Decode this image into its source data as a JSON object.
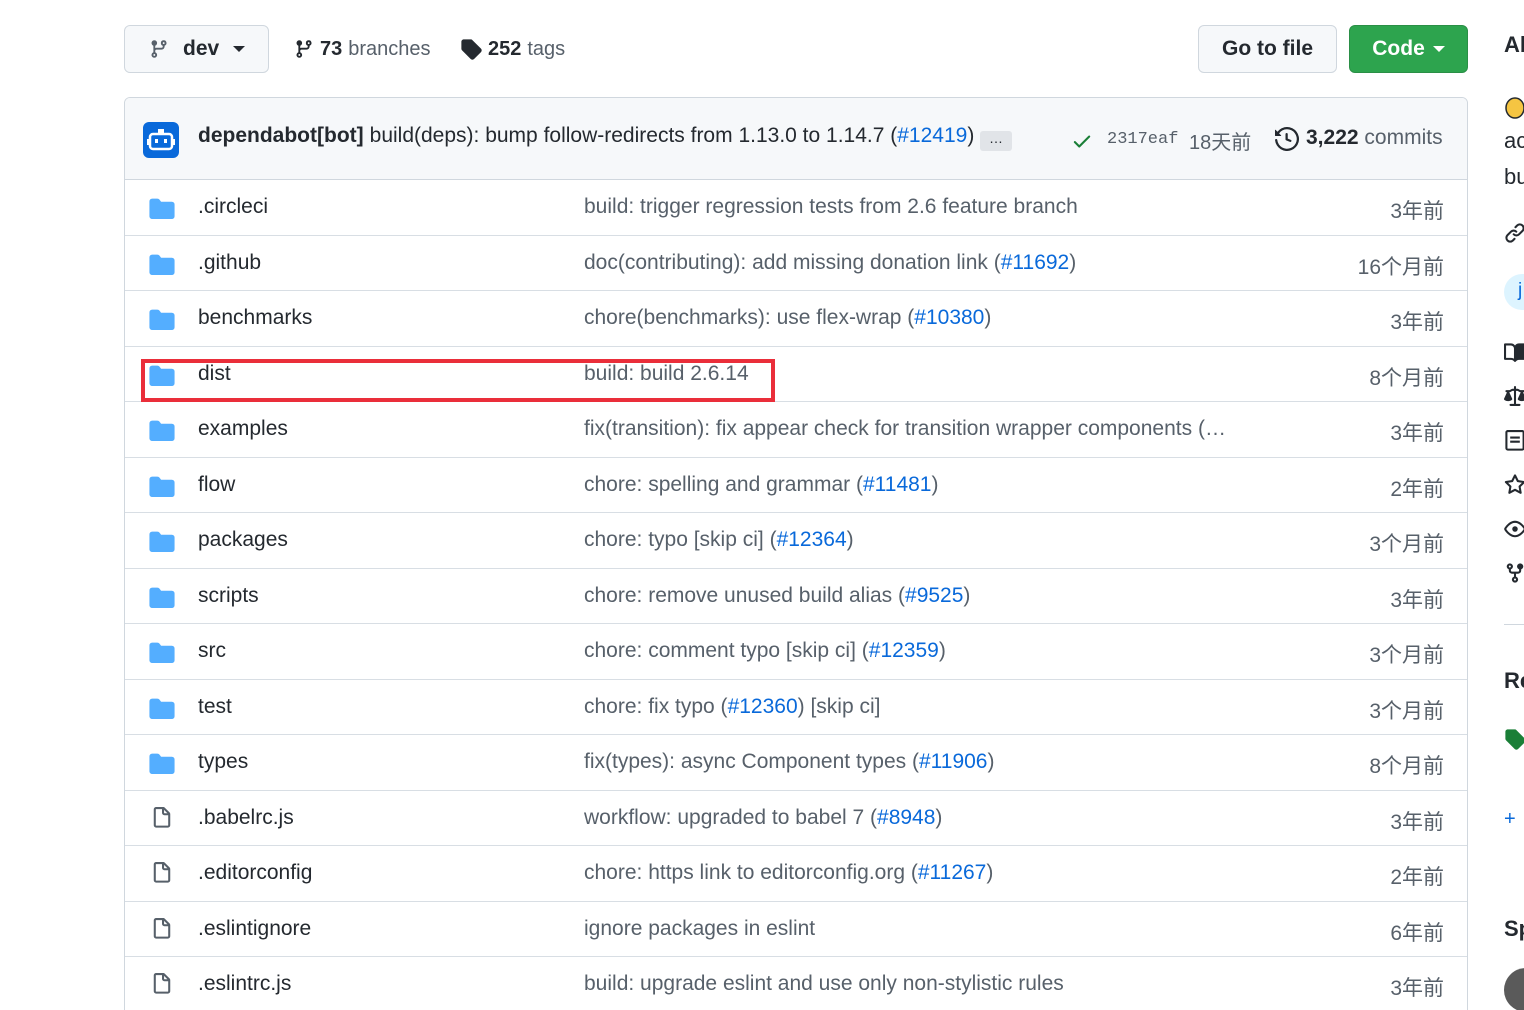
{
  "topbar": {
    "branch": "dev",
    "branches_count": "73",
    "branches_label": "branches",
    "tags_count": "252",
    "tags_label": "tags",
    "go_to_file": "Go to file",
    "code": "Code"
  },
  "commit": {
    "author": "dependabot[bot]",
    "message": "build(deps): bump follow-redirects from 1.13.0 to 1.14.7 (",
    "pr": "#12419",
    "message_end": ")",
    "ellipsis": "…",
    "sha": "2317eaf",
    "age": "18天前",
    "commits_count": "3,222",
    "commits_label": "commits"
  },
  "files": [
    {
      "type": "dir",
      "name": ".circleci",
      "msg": "build: trigger regression tests from 2.6 feature branch",
      "link": "",
      "after": "",
      "time": "3年前"
    },
    {
      "type": "dir",
      "name": ".github",
      "msg": "doc(contributing): add missing donation link (",
      "link": "#11692",
      "after": ")",
      "time": "16个月前"
    },
    {
      "type": "dir",
      "name": "benchmarks",
      "msg": "chore(benchmarks): use flex-wrap (",
      "link": "#10380",
      "after": ")",
      "time": "3年前"
    },
    {
      "type": "dir",
      "name": "dist",
      "msg": "build: build 2.6.14",
      "link": "",
      "after": "",
      "time": "8个月前"
    },
    {
      "type": "dir",
      "name": "examples",
      "msg": "fix(transition): fix appear check for transition wrapper components (",
      "link": "#…",
      "after": "",
      "time": "3年前"
    },
    {
      "type": "dir",
      "name": "flow",
      "msg": "chore: spelling and grammar (",
      "link": "#11481",
      "after": ")",
      "time": "2年前"
    },
    {
      "type": "dir",
      "name": "packages",
      "msg": "chore: typo [skip ci] (",
      "link": "#12364",
      "after": ")",
      "time": "3个月前"
    },
    {
      "type": "dir",
      "name": "scripts",
      "msg": "chore: remove unused build alias (",
      "link": "#9525",
      "after": ")",
      "time": "3年前"
    },
    {
      "type": "dir",
      "name": "src",
      "msg": "chore: comment typo [skip ci] (",
      "link": "#12359",
      "after": ")",
      "time": "3个月前"
    },
    {
      "type": "dir",
      "name": "test",
      "msg": "chore: fix typo (",
      "link": "#12360",
      "after": ") [skip ci]",
      "time": "3个月前"
    },
    {
      "type": "dir",
      "name": "types",
      "msg": "fix(types): async Component types (",
      "link": "#11906",
      "after": ")",
      "time": "8个月前"
    },
    {
      "type": "file",
      "name": ".babelrc.js",
      "msg": "workflow: upgraded to babel 7 (",
      "link": "#8948",
      "after": ")",
      "time": "3年前"
    },
    {
      "type": "file",
      "name": ".editorconfig",
      "msg": "chore: https link to editorconfig.org (",
      "link": "#11267",
      "after": ")",
      "time": "2年前"
    },
    {
      "type": "file",
      "name": ".eslintignore",
      "msg": "ignore packages in eslint",
      "link": "",
      "after": "",
      "time": "6年前"
    },
    {
      "type": "file",
      "name": ".eslintrc.js",
      "msg": "build: upgrade eslint and use only non-stylistic rules",
      "link": "",
      "after": "",
      "time": "3年前"
    }
  ],
  "sidebar": {
    "about": "Ab",
    "desc1": "ac",
    "desc2": "bu",
    "topic": "j",
    "releases": "Re",
    "plus": "+",
    "sponsors": "Sp"
  },
  "colors": {
    "link": "#0969da",
    "folder": "#54aeff",
    "code_button": "#2da44e",
    "highlight": "#ea2e3a"
  }
}
